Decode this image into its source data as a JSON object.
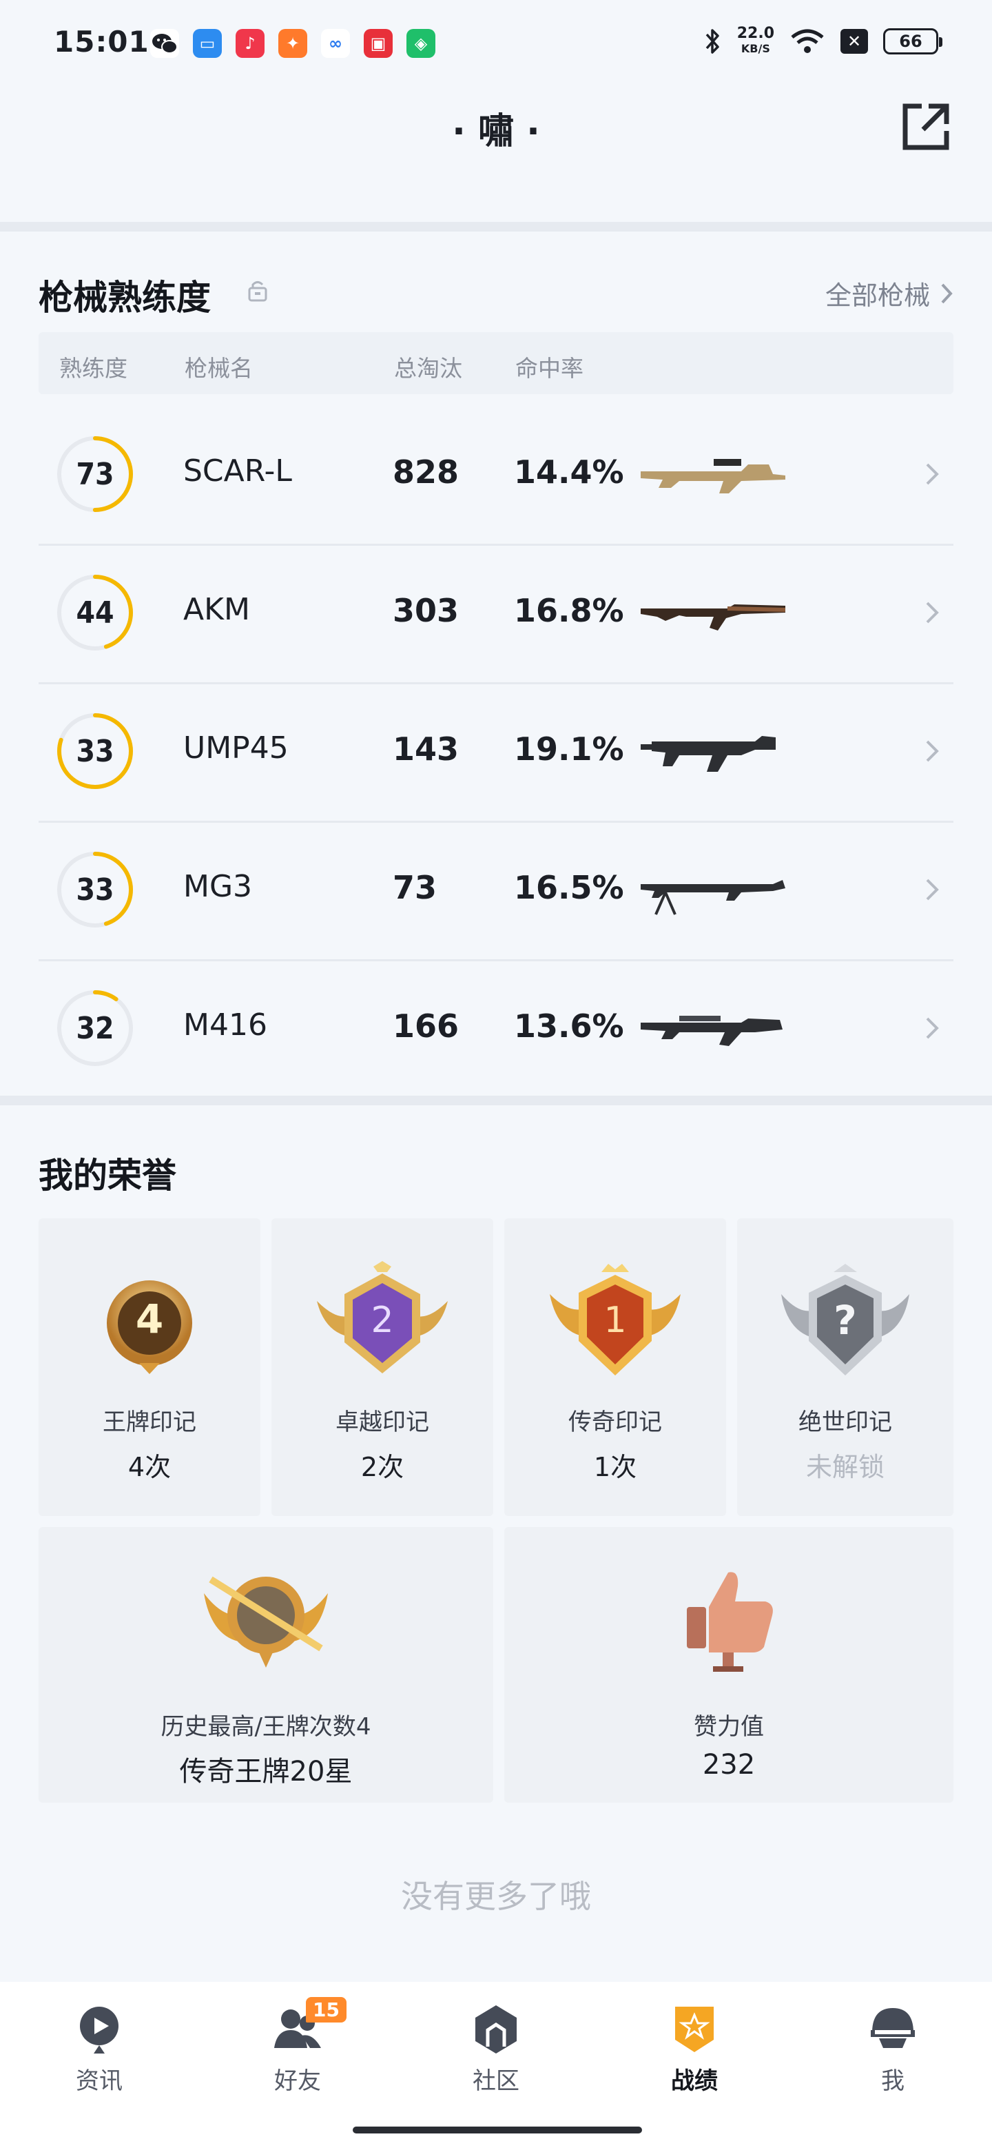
{
  "status_bar": {
    "time": "15:01",
    "net_speed_value": "22.0",
    "net_speed_unit": "KB/S",
    "battery": "66",
    "icons": [
      "wechat-icon",
      "calendar-app-icon",
      "music-app-icon",
      "game-app-icon",
      "cloud-app-icon",
      "shop-app-icon",
      "security-app-icon",
      "bluetooth-icon",
      "wifi-icon"
    ]
  },
  "header": {
    "title": "· 嘯 ·"
  },
  "weapons": {
    "section_title": "枪械熟练度",
    "all_link": "全部枪械",
    "columns": {
      "proficiency": "熟练度",
      "name": "枪械名",
      "kills": "总淘汰",
      "accuracy": "命中率"
    },
    "rows": [
      {
        "proficiency": "73",
        "name": "SCAR-L",
        "kills": "828",
        "accuracy": "14.4%",
        "ring_fraction": 0.5
      },
      {
        "proficiency": "44",
        "name": "AKM",
        "kills": "303",
        "accuracy": "16.8%",
        "ring_fraction": 0.45
      },
      {
        "proficiency": "33",
        "name": "UMP45",
        "kills": "143",
        "accuracy": "19.1%",
        "ring_fraction": 0.8
      },
      {
        "proficiency": "33",
        "name": "MG3",
        "kills": "73",
        "accuracy": "16.5%",
        "ring_fraction": 0.45
      },
      {
        "proficiency": "32",
        "name": "M416",
        "kills": "166",
        "accuracy": "13.6%",
        "ring_fraction": 0.1
      }
    ]
  },
  "honors": {
    "section_title": "我的荣誉",
    "cards": [
      {
        "label": "王牌印记",
        "value": "4次",
        "badge_text": "4"
      },
      {
        "label": "卓越印记",
        "value": "2次",
        "badge_text": "2"
      },
      {
        "label": "传奇印记",
        "value": "1次",
        "badge_text": "1"
      },
      {
        "label": "绝世印记",
        "value": "未解锁",
        "badge_text": "?"
      }
    ],
    "wide_cards": [
      {
        "label": "历史最高/王牌次数4",
        "value": "传奇王牌20星"
      },
      {
        "label": "赞力值",
        "value": "232"
      }
    ]
  },
  "footer_text": "没有更多了哦",
  "bottom_nav": {
    "items": [
      {
        "label": "资讯",
        "icon": "news-play-icon"
      },
      {
        "label": "好友",
        "icon": "friends-icon",
        "badge": "15"
      },
      {
        "label": "社区",
        "icon": "community-icon"
      },
      {
        "label": "战绩",
        "icon": "stats-shield-icon",
        "active": true
      },
      {
        "label": "我",
        "icon": "helmet-profile-icon"
      }
    ]
  },
  "colors": {
    "accent_ring": "#f5b800",
    "background": "#f4f7fb",
    "active_nav": "#f5a623"
  }
}
